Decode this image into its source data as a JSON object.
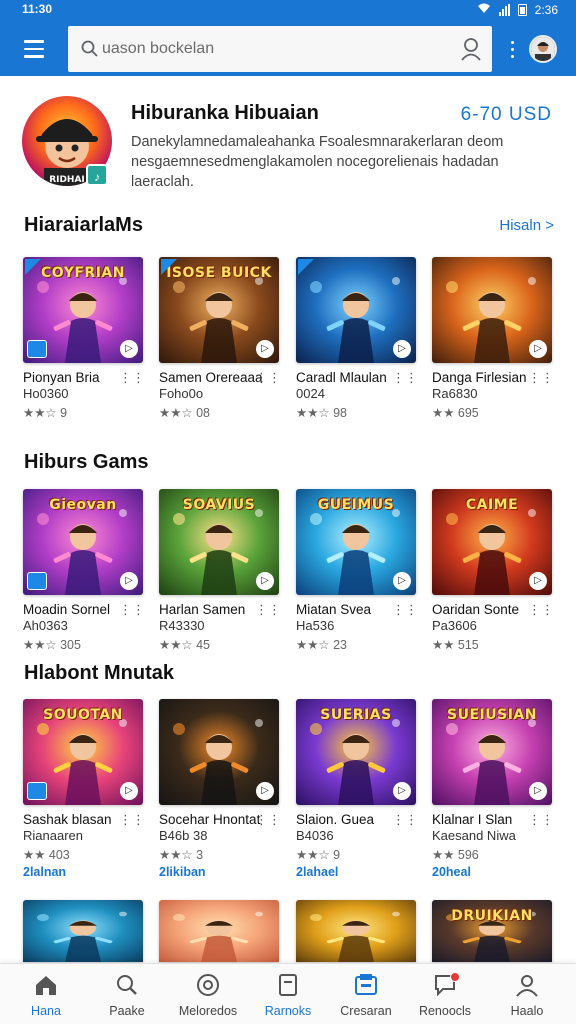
{
  "status_bar": {
    "time": "11:30",
    "battery": "2:36"
  },
  "search": {
    "placeholder": "uason bockelan"
  },
  "developer": {
    "name": "Hiburanka Hibuaian",
    "price": "6-70  USD",
    "description": "Danekylamnedamaleahanka Fsoalesmnarakerlaran deom nesgaemnesedmenglakamolen nocegorelienais hadadan laeraclah.",
    "badge": "♪"
  },
  "sections": [
    {
      "title": "HiaraiarlaMs",
      "see_more": "Hisaln >",
      "cards": [
        {
          "name": "Pionyan Bria",
          "sub": "Ho0360",
          "rating": "★★☆ 9",
          "caption": "COYFRIAN",
          "theme": "purple"
        },
        {
          "name": "Samen Orereaaa",
          "sub": "Foho0o",
          "rating": "★★☆ 08",
          "caption": "ISOSE BUICK",
          "theme": "brown"
        },
        {
          "name": "Caradl Mlaulan",
          "sub": "0024",
          "rating": "★★☆ 98",
          "caption": "",
          "theme": "blue"
        },
        {
          "name": "Danga Firlesian",
          "sub": "Ra6830",
          "rating": "★★ 695",
          "caption": "",
          "theme": "orange"
        }
      ]
    },
    {
      "title": "Hiburs Gams",
      "see_more": "",
      "cards": [
        {
          "name": "Moadin Sornel",
          "sub": "Ah0363",
          "rating": "★★☆ 305",
          "caption": "Gieovan",
          "theme": "purple"
        },
        {
          "name": "Harlan Samen",
          "sub": "R43330",
          "rating": "★★☆ 45",
          "caption": "SOAVIUS",
          "theme": "green"
        },
        {
          "name": "Miatan Svea",
          "sub": "Ha536",
          "rating": "★★☆ 23",
          "caption": "GUEIMUS",
          "theme": "sky"
        },
        {
          "name": "Oaridan Sonte",
          "sub": "Pa3606",
          "rating": "★★ 515",
          "caption": "CAIME",
          "theme": "red"
        }
      ]
    },
    {
      "title": "Hlabont Mnutak",
      "see_more": "",
      "cards": [
        {
          "name": "Sashak blasan",
          "sub": "Rianaaren",
          "rating": "★★ 403",
          "link": "2lalnan",
          "caption": "SOUOTAN",
          "theme": "pink"
        },
        {
          "name": "Socehar Hnontat",
          "sub": "B46b 38",
          "rating": "★★☆ 3",
          "link": "2likiban",
          "caption": "",
          "theme": "dark"
        },
        {
          "name": "Slaion. Guea",
          "sub": "B4036",
          "rating": "★★☆ 9",
          "link": "2lahael",
          "caption": "SUERIAS",
          "theme": "violet"
        },
        {
          "name": "Klalnar I Slan",
          "sub": "Kaesand Niwa",
          "rating": "★★ 596",
          "link": "20heal",
          "caption": "SUEIUSIAN",
          "theme": "magenta"
        }
      ]
    },
    {
      "title": "",
      "see_more": "",
      "cards": [
        {
          "name": "",
          "sub": "",
          "rating": "",
          "caption": "",
          "theme": "teal"
        },
        {
          "name": "",
          "sub": "",
          "rating": "",
          "caption": "",
          "theme": "peach"
        },
        {
          "name": "",
          "sub": "",
          "rating": "",
          "caption": "",
          "theme": "gold"
        },
        {
          "name": "",
          "sub": "",
          "rating": "",
          "caption": "DRUIKIAN",
          "theme": "storm"
        }
      ]
    }
  ],
  "bottom_nav": [
    {
      "label": "Hana",
      "icon": "home-icon",
      "active": true
    },
    {
      "label": "Paake",
      "icon": "search-icon",
      "active": false
    },
    {
      "label": "Meloredos",
      "icon": "explore-icon",
      "active": false
    },
    {
      "label": "Rarnoks",
      "icon": "library-icon",
      "active": true
    },
    {
      "label": "Cresaran",
      "icon": "wallet-icon",
      "active": false
    },
    {
      "label": "Renoocls",
      "icon": "chat-icon",
      "active": false
    },
    {
      "label": "Haalo",
      "icon": "profile-icon",
      "active": false
    }
  ],
  "colors": {
    "primary": "#1976d2",
    "background": "#ffffff",
    "text": "#111111"
  }
}
